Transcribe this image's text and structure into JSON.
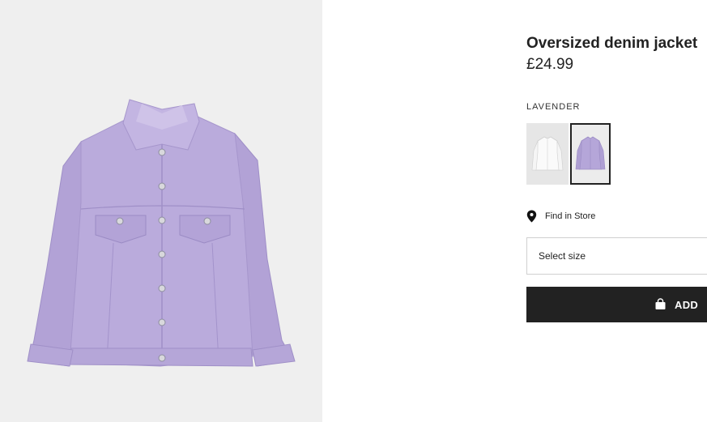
{
  "product": {
    "name": "Oversized denim jacket",
    "price": "£24.99",
    "image_icon": "lavender-denim-jacket-image",
    "selected_color": "LAVENDER"
  },
  "colors": {
    "swatch_white_icon": "white-jacket-swatch",
    "swatch_lavender_icon": "lavender-jacket-swatch",
    "lavender": "#b8a8d9",
    "background_gray": "#efefef"
  },
  "actions": {
    "find_in_store": "Find in Store",
    "find_in_store_icon": "location-pin-icon",
    "select_size": "Select size",
    "add_label": "ADD",
    "add_icon": "shopping-bag-icon",
    "add_button_color": "#222222"
  }
}
